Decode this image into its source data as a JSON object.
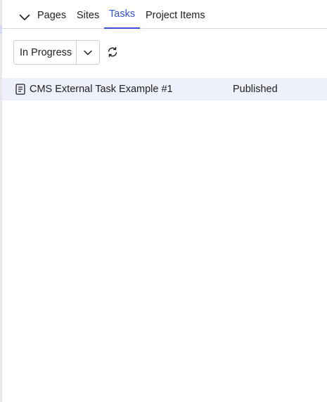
{
  "tabs": [
    {
      "label": "Pages",
      "active": false
    },
    {
      "label": "Sites",
      "active": false
    },
    {
      "label": "Tasks",
      "active": true
    },
    {
      "label": "Project Items",
      "active": false
    }
  ],
  "filter": {
    "selected": "In Progress",
    "toggle_icon": "chevron-down-icon",
    "refresh_icon": "refresh-icon"
  },
  "tasks": [
    {
      "title": "CMS External Task Example #1",
      "status": "Published",
      "icon": "document-icon"
    }
  ],
  "colors": {
    "accent": "#3450d8",
    "row_highlight": "#eef0fb",
    "border": "#d9d9de"
  }
}
